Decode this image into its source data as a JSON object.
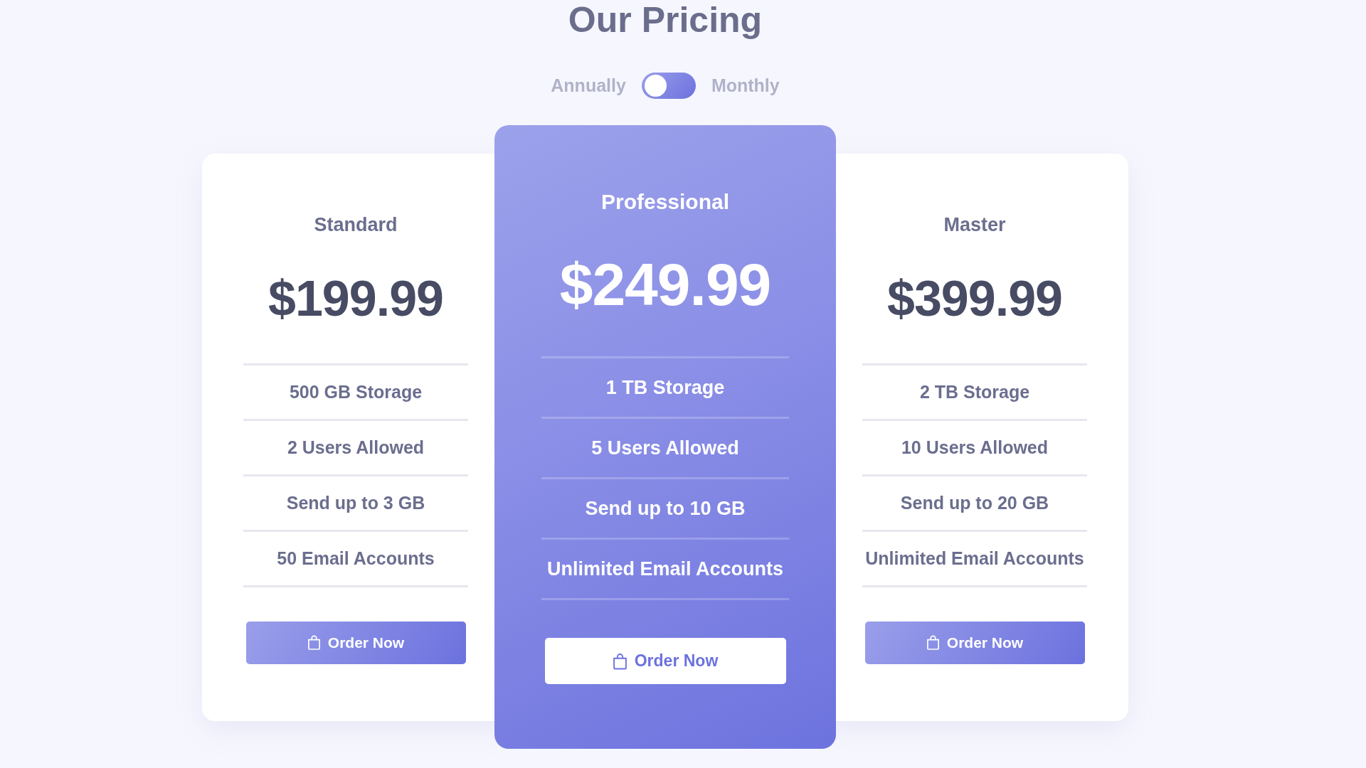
{
  "title": "Our Pricing",
  "billing_toggle": {
    "left_label": "Annually",
    "right_label": "Monthly",
    "on": false
  },
  "plans": [
    {
      "name": "Standard",
      "price": "$199.99",
      "featured": false,
      "features": [
        "500 GB Storage",
        "2 Users Allowed",
        "Send up to 3 GB",
        "50 Email Accounts"
      ],
      "button": "Order Now"
    },
    {
      "name": "Professional",
      "price": "$249.99",
      "featured": true,
      "features": [
        "1 TB Storage",
        "5 Users Allowed",
        "Send up to 10 GB",
        "Unlimited Email Accounts"
      ],
      "button": "Order Now"
    },
    {
      "name": "Master",
      "price": "$399.99",
      "featured": false,
      "features": [
        "2 TB Storage",
        "10 Users Allowed",
        "Send up to 20 GB",
        "Unlimited Email Accounts"
      ],
      "button": "Order Now"
    }
  ]
}
